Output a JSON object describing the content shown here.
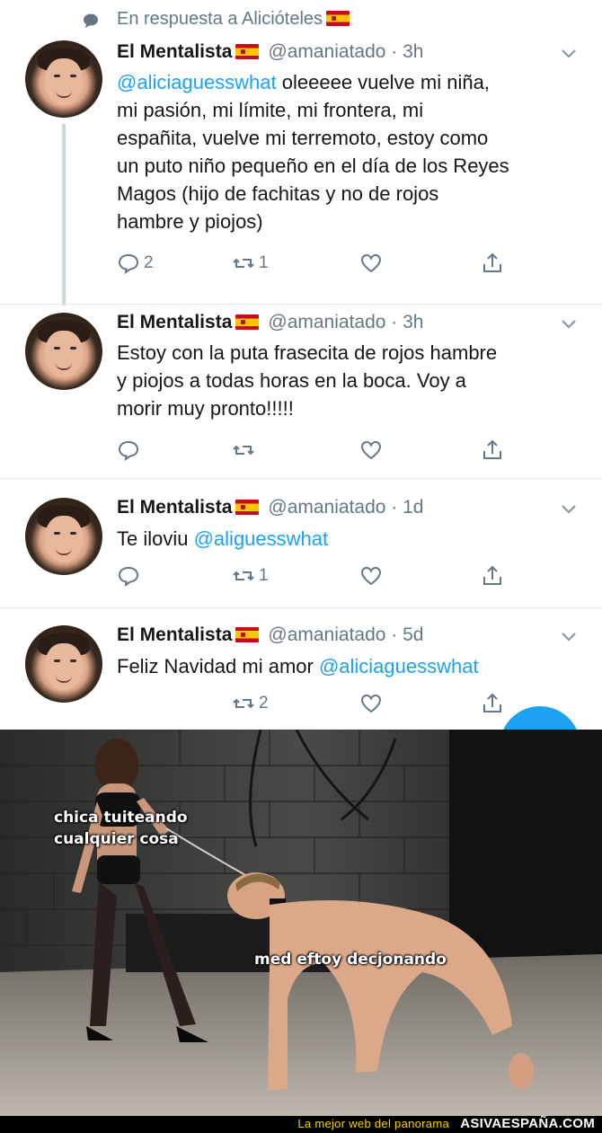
{
  "reply_context": {
    "text": "En respuesta a Alicióteles"
  },
  "tweets": [
    {
      "name": "El Mentalista",
      "handle": "@amaniatado",
      "time": "3h",
      "mention": "@aliciaguesswhat",
      "lines": [
        " oleeeee vuelve mi niña,",
        "mi pasión, mi límite, mi frontera, mi",
        "españita, vuelve mi terremoto, estoy como",
        "un puto niño pequeño en el día de los Reyes",
        "Magos (hijo de fachitas y no de rojos",
        "hambre y piojos)"
      ],
      "replies": "2",
      "retweets": "1",
      "likes": ""
    },
    {
      "name": "El Mentalista",
      "handle": "@amaniatado",
      "time": "3h",
      "lines": [
        "Estoy con la puta frasecita de rojos hambre",
        "y piojos a todas horas en la boca. Voy a",
        "morir muy pronto!!!!!"
      ],
      "replies": "",
      "retweets": "",
      "likes": ""
    },
    {
      "name": "El Mentalista",
      "handle": "@amaniatado",
      "time": "1d",
      "prefix": "Te iloviu ",
      "mention": "@aliguesswhat",
      "replies": "",
      "retweets": "1",
      "likes": ""
    },
    {
      "name": "El Mentalista",
      "handle": "@amaniatado",
      "time": "5d",
      "prefix": "Feliz Navidad mi amor ",
      "mention": "@aliciaguesswhat",
      "replies": "",
      "retweets": "2",
      "likes": ""
    }
  ],
  "meme": {
    "caption_left_1": "chica tuiteando",
    "caption_left_2": "cualquier cosa",
    "caption_right": "med eftoy decjonando"
  },
  "footer": {
    "tagline": "La mejor web del panorama",
    "brand": "ASIVAESPAÑA.COM"
  },
  "colors": {
    "accent": "#1da1f2",
    "secondary_text": "#657786",
    "footer_tag": "#f7d000"
  },
  "icons": [
    "speech-bubble-icon",
    "reply-icon",
    "retweet-icon",
    "like-icon",
    "share-icon",
    "chevron-down-icon",
    "spain-flag-icon"
  ]
}
